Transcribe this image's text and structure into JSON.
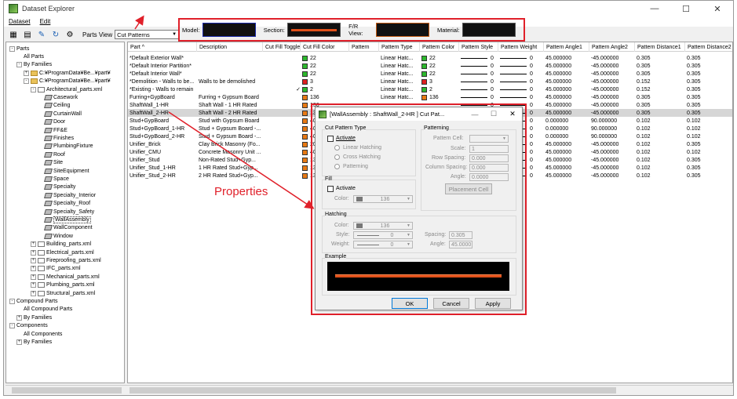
{
  "window": {
    "title": "Dataset Explorer",
    "minimize": "—",
    "maximize": "☐",
    "close": "✕"
  },
  "menu": [
    {
      "label": "Dataset"
    },
    {
      "label": "Edit"
    }
  ],
  "toolbar": {
    "parts_view_label": "Parts View",
    "parts_view_value": "Cut Patterns"
  },
  "preview": {
    "model_label": "Model:",
    "section_label": "Section:",
    "fr_label": "F/R View:",
    "material_label": "Material:",
    "colors": {
      "model_border": "#1b2aa8",
      "section_line": "#e0501a",
      "fr_border": "#c25a14"
    }
  },
  "tree": [
    {
      "label": "Parts",
      "depth": 0,
      "toggle": "-"
    },
    {
      "label": "All Parts",
      "depth": 1,
      "toggle": ""
    },
    {
      "label": "By Families",
      "depth": 1,
      "toggle": "-"
    },
    {
      "label": "C:¥ProgramData¥Be...¥part¥",
      "depth": 2,
      "toggle": "+",
      "icon": "folder"
    },
    {
      "label": "C:¥ProgramData¥Be...¥part¥",
      "depth": 2,
      "toggle": "-",
      "icon": "folder"
    },
    {
      "label": "Architectural_parts.xml",
      "depth": 3,
      "toggle": "-",
      "icon": "file"
    },
    {
      "label": "Casework",
      "depth": 4,
      "icon": "fam"
    },
    {
      "label": "Ceiling",
      "depth": 4,
      "icon": "fam"
    },
    {
      "label": "CurtainWall",
      "depth": 4,
      "icon": "fam"
    },
    {
      "label": "Door",
      "depth": 4,
      "icon": "fam"
    },
    {
      "label": "FF&E",
      "depth": 4,
      "icon": "fam"
    },
    {
      "label": "Finishes",
      "depth": 4,
      "icon": "fam"
    },
    {
      "label": "PlumbingFixture",
      "depth": 4,
      "icon": "fam"
    },
    {
      "label": "Roof",
      "depth": 4,
      "icon": "fam"
    },
    {
      "label": "Site",
      "depth": 4,
      "icon": "fam"
    },
    {
      "label": "SiteEquipment",
      "depth": 4,
      "icon": "fam"
    },
    {
      "label": "Space",
      "depth": 4,
      "icon": "fam"
    },
    {
      "label": "Specialty",
      "depth": 4,
      "icon": "fam"
    },
    {
      "label": "Specialty_Interior",
      "depth": 4,
      "icon": "fam"
    },
    {
      "label": "Specialty_Roof",
      "depth": 4,
      "icon": "fam"
    },
    {
      "label": "Specialty_Safety",
      "depth": 4,
      "icon": "fam"
    },
    {
      "label": "WallAssembly",
      "depth": 4,
      "icon": "fam",
      "selected": true
    },
    {
      "label": "WallComponent",
      "depth": 4,
      "icon": "fam"
    },
    {
      "label": "Window",
      "depth": 4,
      "icon": "fam"
    },
    {
      "label": "Building_parts.xml",
      "depth": 3,
      "toggle": "+",
      "icon": "file"
    },
    {
      "label": "Electrical_parts.xml",
      "depth": 3,
      "toggle": "+",
      "icon": "file"
    },
    {
      "label": "Fireproofing_parts.xml",
      "depth": 3,
      "toggle": "+",
      "icon": "file"
    },
    {
      "label": "IFC_parts.xml",
      "depth": 3,
      "toggle": "+",
      "icon": "file"
    },
    {
      "label": "Mechanical_parts.xml",
      "depth": 3,
      "toggle": "+",
      "icon": "file"
    },
    {
      "label": "Plumbing_parts.xml",
      "depth": 3,
      "toggle": "+",
      "icon": "file"
    },
    {
      "label": "Structural_parts.xml",
      "depth": 3,
      "toggle": "+",
      "icon": "file"
    },
    {
      "label": "Compound Parts",
      "depth": 0,
      "toggle": "-"
    },
    {
      "label": "All Compound Parts",
      "depth": 1,
      "toggle": ""
    },
    {
      "label": "By Families",
      "depth": 1,
      "toggle": "+"
    },
    {
      "label": "Components",
      "depth": 0,
      "toggle": "-"
    },
    {
      "label": "All Components",
      "depth": 1,
      "toggle": ""
    },
    {
      "label": "By Families",
      "depth": 1,
      "toggle": "+"
    }
  ],
  "grid": {
    "columns": [
      "Part ^",
      "Description",
      "Cut Fill Toggle",
      "Cut Fill Color",
      "Pattern",
      "Pattern Type",
      "Pattern Color",
      "Pattern Style",
      "Pattern Weight",
      "Pattern Angle1",
      "Pattern Angle2",
      "Pattern Distance1",
      "Pattern Distance2"
    ],
    "rows": [
      {
        "part": "*Default Exterior Wall*",
        "desc": "",
        "toggle": "",
        "fill": "22",
        "fillc": "#2db82d",
        "ptype": "Linear Hatc...",
        "pcol": "22",
        "pcolc": "#2db82d",
        "style": "0",
        "weight": "0",
        "a1": "45.000000",
        "a2": "-45.000000",
        "d1": "0.305",
        "d2": "0.305"
      },
      {
        "part": "*Default Interior Partition*",
        "desc": "",
        "toggle": "",
        "fill": "22",
        "fillc": "#2db82d",
        "ptype": "Linear Hatc...",
        "pcol": "22",
        "pcolc": "#2db82d",
        "style": "0",
        "weight": "0",
        "a1": "45.000000",
        "a2": "-45.000000",
        "d1": "0.305",
        "d2": "0.305"
      },
      {
        "part": "*Default Interior Wall*",
        "desc": "",
        "toggle": "",
        "fill": "22",
        "fillc": "#2db82d",
        "ptype": "Linear Hatc...",
        "pcol": "22",
        "pcolc": "#2db82d",
        "style": "0",
        "weight": "0",
        "a1": "45.000000",
        "a2": "-45.000000",
        "d1": "0.305",
        "d2": "0.305"
      },
      {
        "part": "*Demolition - Walls to be...",
        "desc": "Walls to be demolished",
        "toggle": "",
        "fill": "3",
        "fillc": "#e02020",
        "ptype": "Linear Hatc...",
        "pcol": "3",
        "pcolc": "#e02020",
        "style": "0",
        "weight": "0",
        "a1": "45.000000",
        "a2": "-45.000000",
        "d1": "0.152",
        "d2": "0.305"
      },
      {
        "part": "*Existing - Walls to remain",
        "desc": "",
        "toggle": "✓",
        "fill": "2",
        "fillc": "#2db82d",
        "ptype": "Linear Hatc...",
        "pcol": "2",
        "pcolc": "#2db82d",
        "style": "0",
        "weight": "0",
        "a1": "45.000000",
        "a2": "-45.000000",
        "d1": "0.152",
        "d2": "0.305"
      },
      {
        "part": "Furring+GypBoard",
        "desc": "Furring + Gypsum Board",
        "toggle": "",
        "fill": "136",
        "fillc": "#e87a14",
        "ptype": "Linear Hatc...",
        "pcol": "136",
        "pcolc": "#e87a14",
        "style": "0",
        "weight": "0",
        "a1": "45.000000",
        "a2": "-45.000000",
        "d1": "0.305",
        "d2": "0.305"
      },
      {
        "part": "ShaftWall_1-HR",
        "desc": "Shaft Wall - 1 HR Rated",
        "toggle": "",
        "fill": "136",
        "fillc": "#e87a14",
        "ptype": "",
        "pcol": "",
        "pcolc": "",
        "style": "0",
        "weight": "0",
        "a1": "45.000000",
        "a2": "-45.000000",
        "d1": "0.305",
        "d2": "0.305"
      },
      {
        "part": "ShaftWall_2-HR",
        "desc": "Shaft Wall - 2 HR Rated",
        "toggle": "",
        "fill": "13",
        "fillc": "#e87a14",
        "ptype": "",
        "pcol": "",
        "pcolc": "",
        "style": "0",
        "weight": "0",
        "a1": "45.000000",
        "a2": "-45.000000",
        "d1": "0.305",
        "d2": "0.305",
        "hl": true
      },
      {
        "part": "Stud+GypBoard",
        "desc": "Stud with Gypsum Board",
        "toggle": "",
        "fill": "40",
        "fillc": "#e87a14",
        "ptype": "",
        "pcol": "",
        "pcolc": "",
        "style": "0",
        "weight": "0",
        "a1": "0.000000",
        "a2": "90.000000",
        "d1": "0.102",
        "d2": "0.102"
      },
      {
        "part": "Stud+GypBoard_1-HR",
        "desc": "Stud + Gypsum Board -...",
        "toggle": "",
        "fill": "40",
        "fillc": "#e87a14",
        "ptype": "",
        "pcol": "",
        "pcolc": "",
        "style": "0",
        "weight": "0",
        "a1": "0.000000",
        "a2": "90.000000",
        "d1": "0.102",
        "d2": "0.102"
      },
      {
        "part": "Stud+GypBoard_2-HR",
        "desc": "Stud + Gypsum Board -...",
        "toggle": "",
        "fill": "40",
        "fillc": "#e87a14",
        "ptype": "",
        "pcol": "",
        "pcolc": "",
        "style": "0",
        "weight": "0",
        "a1": "0.000000",
        "a2": "90.000000",
        "d1": "0.102",
        "d2": "0.102"
      },
      {
        "part": "Unifier_Brick",
        "desc": "Clay Brick Masonry (Fo...",
        "toggle": "",
        "fill": "20",
        "fillc": "#e87a14",
        "ptype": "",
        "pcol": "",
        "pcolc": "",
        "style": "0",
        "weight": "0",
        "a1": "45.000000",
        "a2": "-45.000000",
        "d1": "0.102",
        "d2": "0.305"
      },
      {
        "part": "Unifier_CMU",
        "desc": "Concrete Masonry Unit ...",
        "toggle": "",
        "fill": "40",
        "fillc": "#e87a14",
        "ptype": "",
        "pcol": "",
        "pcolc": "",
        "style": "0",
        "weight": "0",
        "a1": "45.000000",
        "a2": "-45.000000",
        "d1": "0.102",
        "d2": "0.102"
      },
      {
        "part": "Unifier_Stud",
        "desc": "Non-Rated Stud+Gyp...",
        "toggle": "",
        "fill": "13",
        "fillc": "#e87a14",
        "ptype": "",
        "pcol": "",
        "pcolc": "",
        "style": "0",
        "weight": "0",
        "a1": "45.000000",
        "a2": "-45.000000",
        "d1": "0.102",
        "d2": "0.305"
      },
      {
        "part": "Unifier_Stud_1-HR",
        "desc": "1 HR Rated Stud+Gyp...",
        "toggle": "",
        "fill": "13",
        "fillc": "#e87a14",
        "ptype": "",
        "pcol": "",
        "pcolc": "",
        "style": "0",
        "weight": "0",
        "a1": "45.000000",
        "a2": "-45.000000",
        "d1": "0.102",
        "d2": "0.305"
      },
      {
        "part": "Unifier_Stud_2-HR",
        "desc": "2 HR Rated Stud+Gyp...",
        "toggle": "",
        "fill": "13",
        "fillc": "#e87a14",
        "ptype": "",
        "pcol": "",
        "pcolc": "",
        "style": "0",
        "weight": "0",
        "a1": "45.000000",
        "a2": "-45.000000",
        "d1": "0.102",
        "d2": "0.305"
      }
    ]
  },
  "annotation": {
    "label": "Properties",
    "color": "#e0202a"
  },
  "dialog": {
    "title": "[WallAssembly : ShaftWall_2-HR ] Cut Pat...",
    "title_min": "—",
    "title_max": "☐",
    "title_close": "✕",
    "cut_pattern_type": "Cut Pattern Type",
    "activate": "Activate",
    "linear_hatching": "Linear Hatching",
    "cross_hatching": "Cross Hatching",
    "patterning": "Patterning",
    "patterning_group": "Patterning",
    "pattern_cell": "Pattern Cell:",
    "scale": "Scale:",
    "scale_val": "1",
    "row_spacing": "Row Spacing:",
    "row_spacing_val": "0.000",
    "col_spacing": "Column Spacing:",
    "col_spacing_val": "0.000",
    "angle": "Angle:",
    "angle_p_val": "0.0000",
    "placement_cell": "Placement Cell",
    "fill_group": "Fill",
    "fill_activate": "Activate",
    "color": "Color:",
    "fill_color_val": "136",
    "hatching_group": "Hatching",
    "hatch_color_val": "136",
    "style": "Style:",
    "style_val": "0",
    "weight": "Weight:",
    "weight_val": "0",
    "spacing": "Spacing:",
    "spacing_val": "0.305",
    "hatch_angle": "Angle:",
    "hatch_angle_val": "45.0000",
    "example": "Example",
    "ok": "OK",
    "cancel": "Cancel",
    "apply": "Apply"
  }
}
